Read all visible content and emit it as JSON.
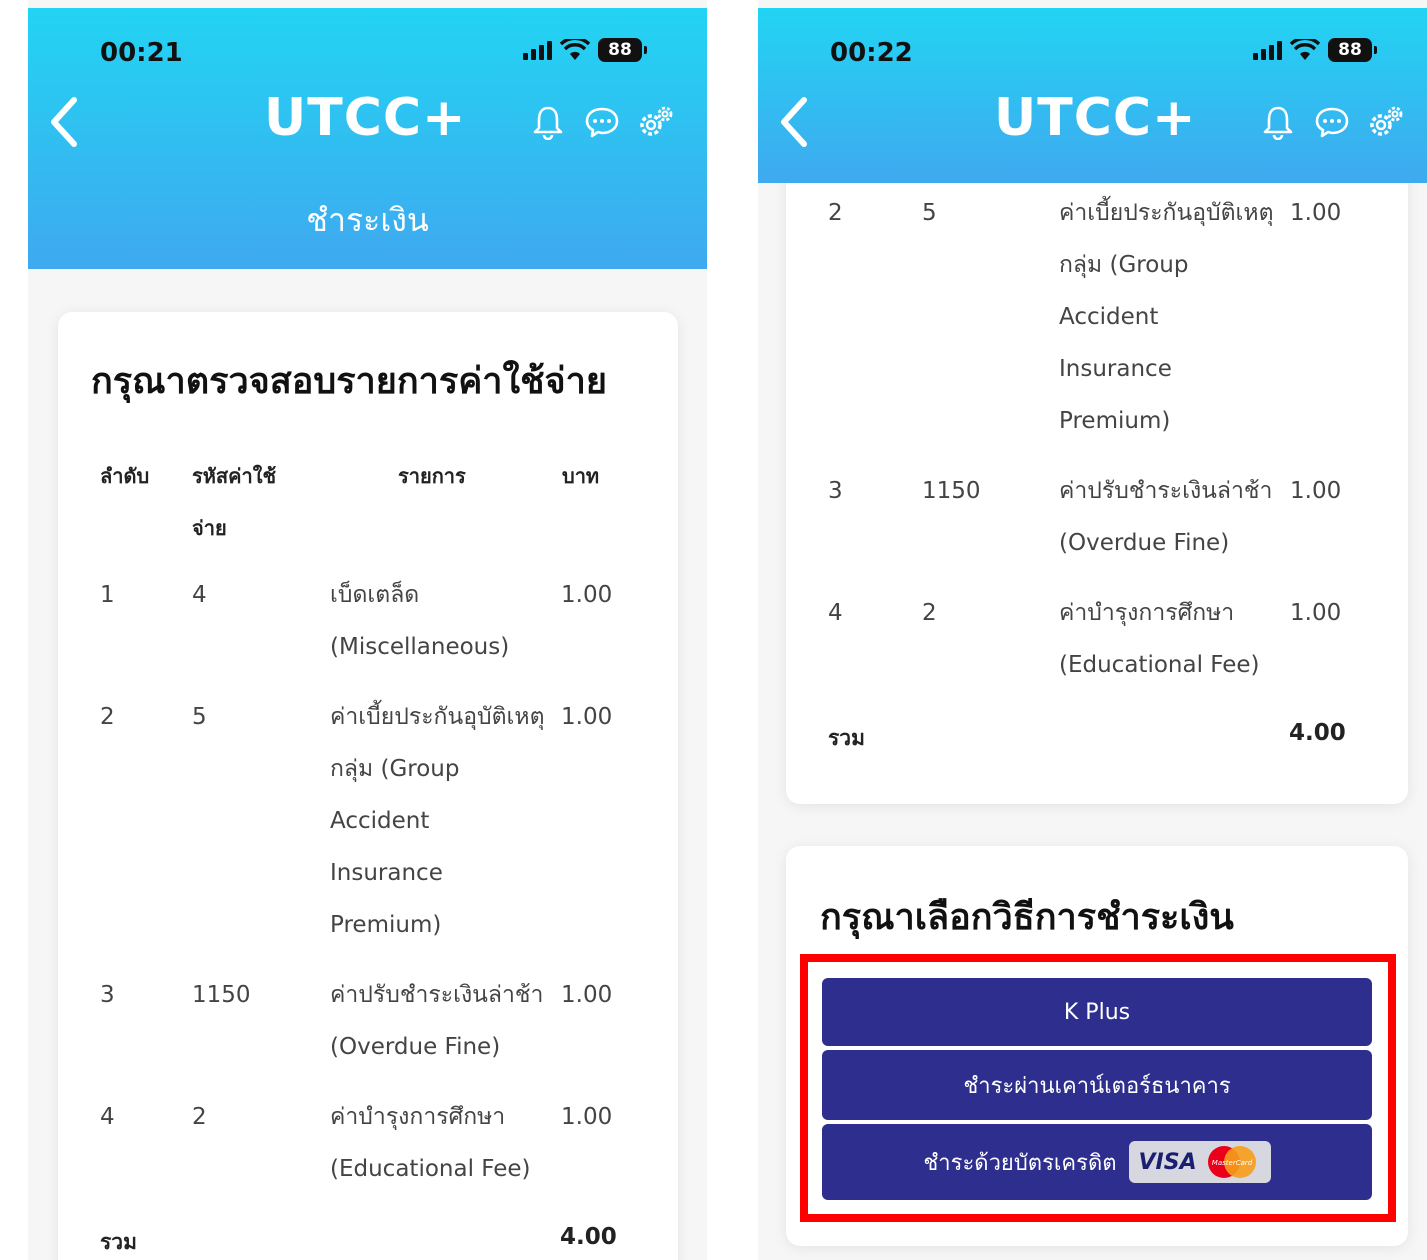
{
  "left": {
    "time": "00:21",
    "battery": "88",
    "app_title": "UTCC+",
    "subtitle": "ชำระเงิน",
    "card_title": "กรุณาตรวจสอบรายการค่าใช้จ่าย",
    "headers": {
      "no": "ลำดับ",
      "code1": "รหัสค่าใช้",
      "code2": "จ่าย",
      "item": "รายการ",
      "amount": "บาท"
    },
    "rows": [
      {
        "no": "1",
        "code": "4",
        "lines": [
          "เบ็ดเตล็ด",
          "(Miscellaneous)"
        ],
        "amount": "1.00"
      },
      {
        "no": "2",
        "code": "5",
        "lines": [
          "ค่าเบี้ยประกันอุบัติเหตุ",
          "กลุ่ม (Group",
          "Accident",
          "Insurance",
          "Premium)"
        ],
        "amount": "1.00"
      },
      {
        "no": "3",
        "code": "1150",
        "lines": [
          "ค่าปรับชำระเงินล่าช้า",
          "(Overdue Fine)"
        ],
        "amount": "1.00"
      },
      {
        "no": "4",
        "code": "2",
        "lines": [
          "ค่าบำรุงการศึกษา",
          "(Educational Fee)"
        ],
        "amount": "1.00"
      }
    ],
    "total_label": "รวม",
    "total_amount": "4.00"
  },
  "right": {
    "time": "00:22",
    "battery": "88",
    "app_title": "UTCC+",
    "rows": [
      {
        "no": "2",
        "code": "5",
        "lines": [
          "ค่าเบี้ยประกันอุบัติเหตุ",
          "กลุ่ม (Group",
          "Accident",
          "Insurance",
          "Premium)"
        ],
        "amount": "1.00"
      },
      {
        "no": "3",
        "code": "1150",
        "lines": [
          "ค่าปรับชำระเงินล่าช้า",
          "(Overdue Fine)"
        ],
        "amount": "1.00"
      },
      {
        "no": "4",
        "code": "2",
        "lines": [
          "ค่าบำรุงการศึกษา",
          "(Educational Fee)"
        ],
        "amount": "1.00"
      }
    ],
    "total_label": "รวม",
    "total_amount": "4.00",
    "pay_title": "กรุณาเลือกวิธีการชำระเงิน",
    "pay_buttons": {
      "kplus": "K Plus",
      "counter": "ชำระผ่านเคาน์เตอร์ธนาคาร",
      "credit": "ชำระด้วยบัตรเครดิต"
    },
    "visa": "VISA",
    "mastercard": "MasterCard"
  },
  "colors": {
    "header_top": "#22d4f3",
    "header_bottom": "#3fa9ef",
    "button": "#2e2e8e",
    "highlight": "#ff0000"
  }
}
